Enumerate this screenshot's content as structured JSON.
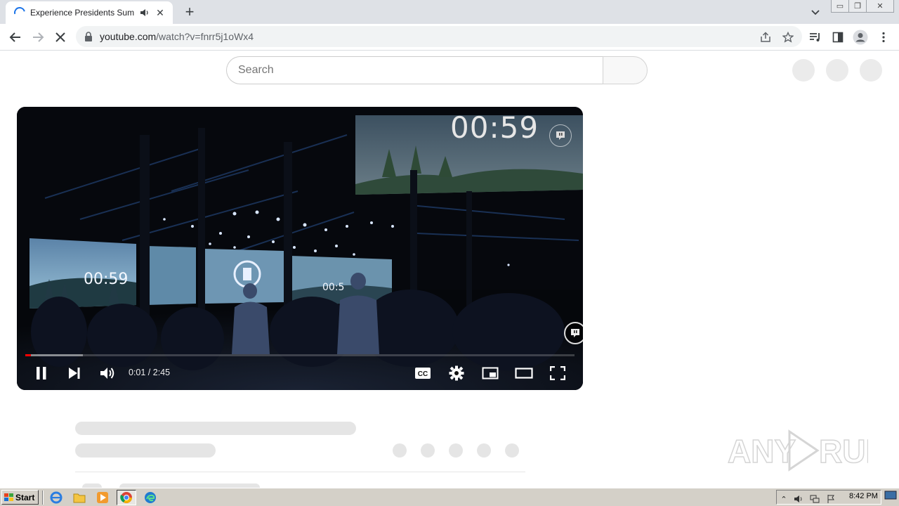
{
  "browser": {
    "tab": {
      "title": "Experience Presidents Summit",
      "state": "loading",
      "audio": "playing"
    },
    "new_tab_label": "+",
    "url": {
      "domain": "youtube.com",
      "path": "/watch?v=fnrr5j1oWx4"
    }
  },
  "youtube": {
    "search": {
      "placeholder": "Search"
    },
    "player": {
      "current_time": "0:01",
      "duration": "2:45",
      "time_display": "0:01 / 2:45",
      "progress_played": 0.01,
      "progress_buffered": 0.105,
      "overlay_clock": "00:59",
      "controls": [
        "pause-icon",
        "next-icon",
        "volume-icon",
        "cc-icon",
        "settings-icon",
        "miniplayer-icon",
        "theater-icon",
        "fullscreen-icon"
      ]
    }
  },
  "watermark": {
    "text": "ANY RUN"
  },
  "taskbar": {
    "start_label": "Start",
    "apps": [
      "ie-icon",
      "explorer-icon",
      "media-player-icon",
      "chrome-icon",
      "edge-icon"
    ],
    "clock": "8:42 PM"
  },
  "colors": {
    "progress": "#ff0000",
    "chrome_blue": "#1a73e8",
    "taskbar": "#d4d0c8"
  }
}
